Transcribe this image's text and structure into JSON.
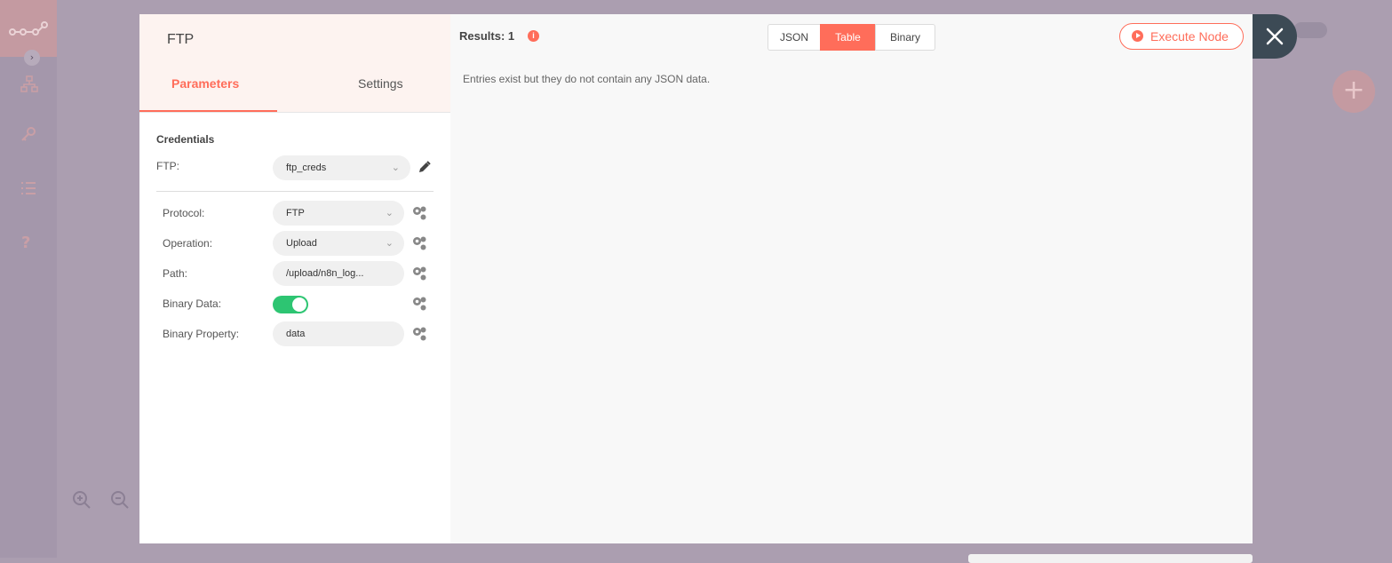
{
  "app": {
    "icons": [
      "logo-icon",
      "network-icon",
      "key-icon",
      "list-icon",
      "help-icon",
      "zoom-in-icon",
      "zoom-out-icon",
      "plus-icon"
    ]
  },
  "node": {
    "title": "FTP",
    "tabs": {
      "parameters": "Parameters",
      "settings": "Settings"
    },
    "credentials_title": "Credentials",
    "credential_label": "FTP:",
    "credential_value": "ftp_creds",
    "params": [
      {
        "label": "Protocol:",
        "value": "FTP"
      },
      {
        "label": "Operation:",
        "value": "Upload"
      },
      {
        "label": "Path:",
        "value": "/upload/n8n_log..."
      },
      {
        "label": "Binary Data:",
        "value": true
      },
      {
        "label": "Binary Property:",
        "value": "data"
      }
    ]
  },
  "output": {
    "results_label": "Results: 1",
    "info_glyph": "i",
    "views": {
      "json": "JSON",
      "table": "Table",
      "binary": "Binary"
    },
    "active_view": "Table",
    "execute_label": "Execute Node",
    "empty_message": "Entries exist but they do not contain any JSON data."
  },
  "colors": {
    "accent": "#ff6d5a",
    "toggle_on": "#2dc572",
    "close_bg": "#3c4a55"
  }
}
